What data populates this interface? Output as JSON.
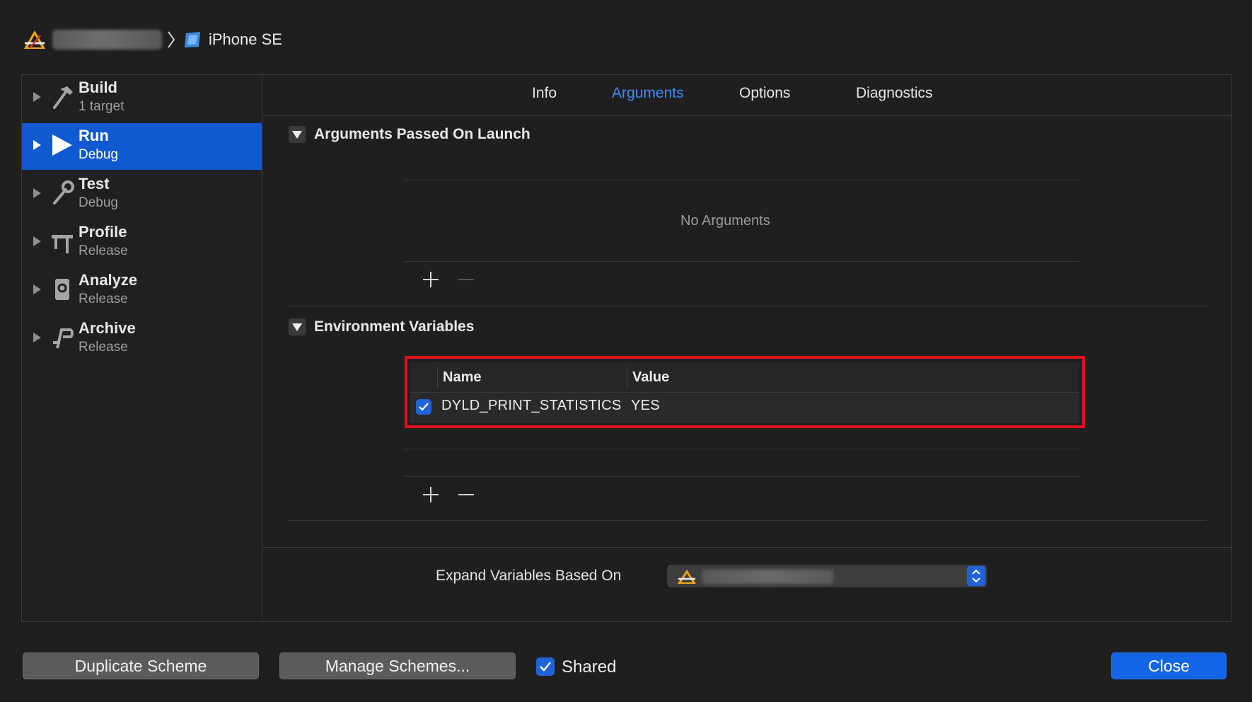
{
  "breadcrumb": {
    "project_icon": "xcode-app-icon",
    "device_icon": "device-icon",
    "device": "iPhone SE"
  },
  "sidebar": {
    "items": [
      {
        "title": "Build",
        "subtitle": "1 target",
        "icon": "hammer-icon",
        "selected": false
      },
      {
        "title": "Run",
        "subtitle": "Debug",
        "icon": "play-icon",
        "selected": true
      },
      {
        "title": "Test",
        "subtitle": "Debug",
        "icon": "wrench-icon",
        "selected": false
      },
      {
        "title": "Profile",
        "subtitle": "Release",
        "icon": "caliper-icon",
        "selected": false
      },
      {
        "title": "Analyze",
        "subtitle": "Release",
        "icon": "analyze-icon",
        "selected": false
      },
      {
        "title": "Archive",
        "subtitle": "Release",
        "icon": "archive-icon",
        "selected": false
      }
    ]
  },
  "tabs": [
    "Info",
    "Arguments",
    "Options",
    "Diagnostics"
  ],
  "active_tab": "Arguments",
  "arguments_section": {
    "title": "Arguments Passed On Launch",
    "empty_message": "No Arguments"
  },
  "env_section": {
    "title": "Environment Variables",
    "columns": [
      "Name",
      "Value"
    ],
    "rows": [
      {
        "enabled": true,
        "name": "DYLD_PRINT_STATISTICS",
        "value": "YES"
      }
    ]
  },
  "expand": {
    "label": "Expand Variables Based On"
  },
  "footer": {
    "duplicate": "Duplicate Scheme",
    "manage": "Manage Schemes...",
    "shared_label": "Shared",
    "shared_checked": true,
    "close": "Close"
  },
  "colors": {
    "accent": "#1464e6",
    "active_tab": "#3f8cf5",
    "highlight_box": "#e0101c",
    "selection": "#0f59d1"
  }
}
